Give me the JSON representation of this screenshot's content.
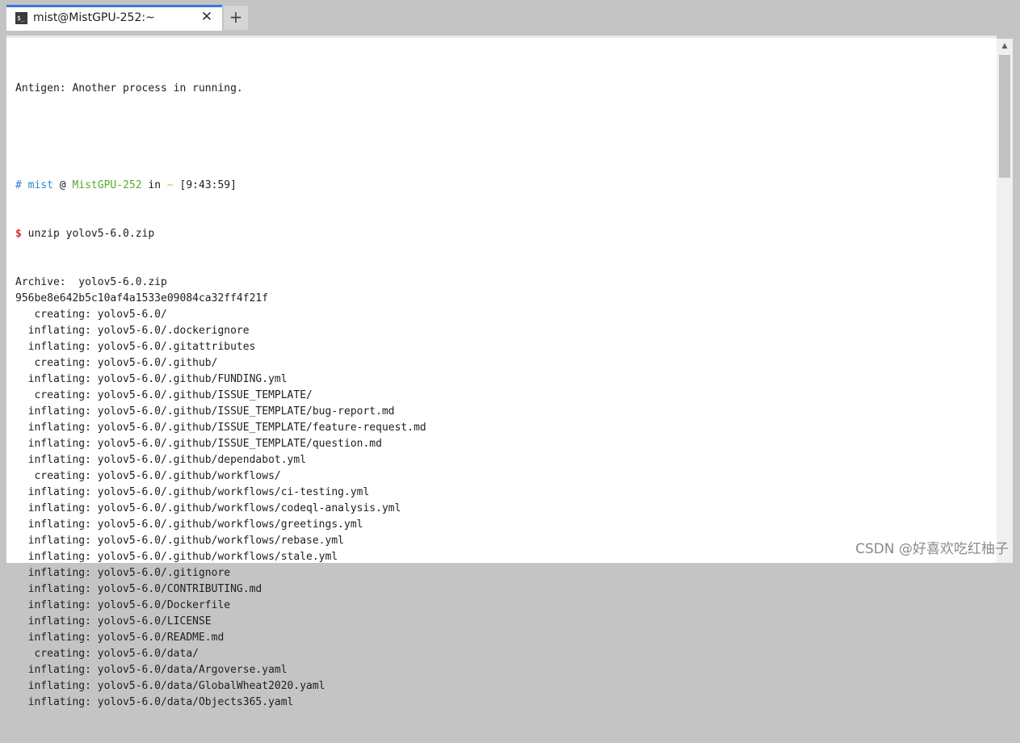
{
  "tab": {
    "icon": "terminal-icon",
    "icon_glyph": "$_",
    "title": "mist@MistGPU-252:~",
    "close_glyph": "✕"
  },
  "new_tab_glyph": "+",
  "terminal": {
    "notice": "Antigen: Another process in running.",
    "prompt": {
      "hash": "#",
      "user": "mist",
      "at": "@",
      "host": "MistGPU-252",
      "in": "in",
      "dir": "~",
      "time": "[9:43:59]"
    },
    "command_symbol": "$",
    "command": "unzip yolov5-6.0.zip",
    "output_lines": [
      "Archive:  yolov5-6.0.zip",
      "956be8e642b5c10af4a1533e09084ca32ff4f21f",
      "   creating: yolov5-6.0/",
      "  inflating: yolov5-6.0/.dockerignore",
      "  inflating: yolov5-6.0/.gitattributes",
      "   creating: yolov5-6.0/.github/",
      "  inflating: yolov5-6.0/.github/FUNDING.yml",
      "   creating: yolov5-6.0/.github/ISSUE_TEMPLATE/",
      "  inflating: yolov5-6.0/.github/ISSUE_TEMPLATE/bug-report.md",
      "  inflating: yolov5-6.0/.github/ISSUE_TEMPLATE/feature-request.md",
      "  inflating: yolov5-6.0/.github/ISSUE_TEMPLATE/question.md",
      "  inflating: yolov5-6.0/.github/dependabot.yml",
      "   creating: yolov5-6.0/.github/workflows/",
      "  inflating: yolov5-6.0/.github/workflows/ci-testing.yml",
      "  inflating: yolov5-6.0/.github/workflows/codeql-analysis.yml",
      "  inflating: yolov5-6.0/.github/workflows/greetings.yml",
      "  inflating: yolov5-6.0/.github/workflows/rebase.yml",
      "  inflating: yolov5-6.0/.github/workflows/stale.yml",
      "  inflating: yolov5-6.0/.gitignore",
      "  inflating: yolov5-6.0/CONTRIBUTING.md",
      "  inflating: yolov5-6.0/Dockerfile",
      "  inflating: yolov5-6.0/LICENSE",
      "  inflating: yolov5-6.0/README.md",
      "   creating: yolov5-6.0/data/",
      "  inflating: yolov5-6.0/data/Argoverse.yaml",
      "  inflating: yolov5-6.0/data/GlobalWheat2020.yaml",
      "  inflating: yolov5-6.0/data/Objects365.yaml"
    ]
  },
  "watermark": "CSDN @好喜欢吃红柚子"
}
